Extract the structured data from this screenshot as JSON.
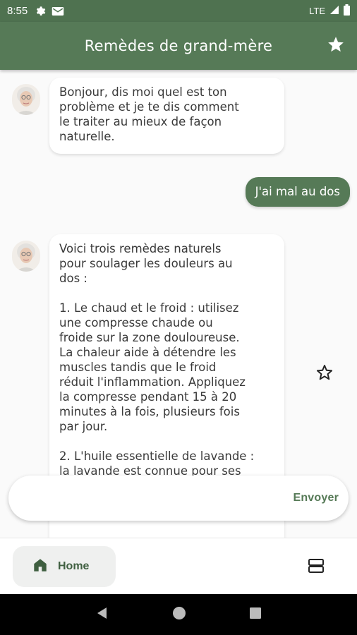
{
  "status_bar": {
    "time": "8:55",
    "network": "LTE"
  },
  "app_bar": {
    "title": "Remèdes de grand-mère",
    "favorites_icon": "star-icon"
  },
  "messages": [
    {
      "from": "bot",
      "text": "Bonjour, dis moi quel est ton\nproblème et je te dis comment\nle traiter au mieux de façon\nnaturelle."
    },
    {
      "from": "user",
      "text": "J'ai mal au dos"
    },
    {
      "from": "bot",
      "text": "Voici trois remèdes naturels\npour soulager les douleurs au\ndos :\n\n1. Le chaud et le froid : utilisez\nune compresse chaude ou\nfroide sur la zone douloureuse.\nLa chaleur aide à détendre les\nmuscles tandis que le froid\nréduit l'inflammation. Appliquez\nla compresse pendant 15 à 20\nminutes à la fois, plusieurs fois\npar jour.\n\n2. L'huile essentielle de lavande :\nla lavande est connue pour ses"
    }
  ],
  "composer": {
    "placeholder": "",
    "send_label": "Envoyer"
  },
  "bottom_nav": {
    "home_label": "Home"
  },
  "colors": {
    "primary": "#567a57",
    "status_bar": "#4f7250",
    "background": "#fafafa"
  }
}
